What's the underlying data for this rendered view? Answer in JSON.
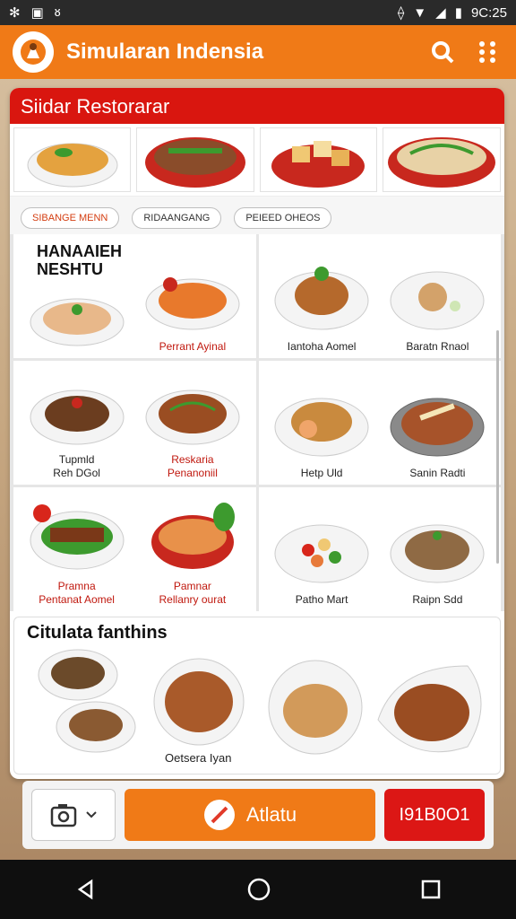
{
  "status_bar": {
    "time": "9C:25"
  },
  "app": {
    "title": "Simularan Indensia"
  },
  "card": {
    "header": "Siidar Restorarar"
  },
  "tabs": [
    {
      "label": "SIBANGE MENN"
    },
    {
      "label": "RIDAANGANG"
    },
    {
      "label": "PEIEED OHEOS"
    }
  ],
  "promo": {
    "line1": "HANAAIEH",
    "line2": "NESHTU"
  },
  "grid": [
    {
      "left": {
        "name": ""
      },
      "right": {
        "name": "Perrant Ayinal",
        "red": true
      }
    },
    {
      "left": {
        "name": "Iantoha Aomel"
      },
      "right": {
        "name": "Baratn Rnaol"
      }
    },
    {
      "left": {
        "name": "Tupmld\nReh DGol"
      },
      "right": {
        "name": "Reskaria\nPenanoniil",
        "red": true
      }
    },
    {
      "left": {
        "name": "Hetp Uld"
      },
      "right": {
        "name": "Sanin Radti"
      }
    },
    {
      "left": {
        "name": "Pramna\nPentanat Aomel",
        "red": true
      },
      "right": {
        "name": "Pamnar\nRellanry ourat",
        "red": true
      }
    },
    {
      "left": {
        "name": "Patho Mart"
      },
      "right": {
        "name": "Raipn Sdd"
      }
    }
  ],
  "featured": {
    "title": "Citulata fanthins",
    "dish_name": "Oetsera Iyan"
  },
  "bottom": {
    "main_button": "Atlatu",
    "code_button": "I91B0O1"
  },
  "colors": {
    "primary": "#f07a17",
    "header_red": "#d9160f"
  }
}
